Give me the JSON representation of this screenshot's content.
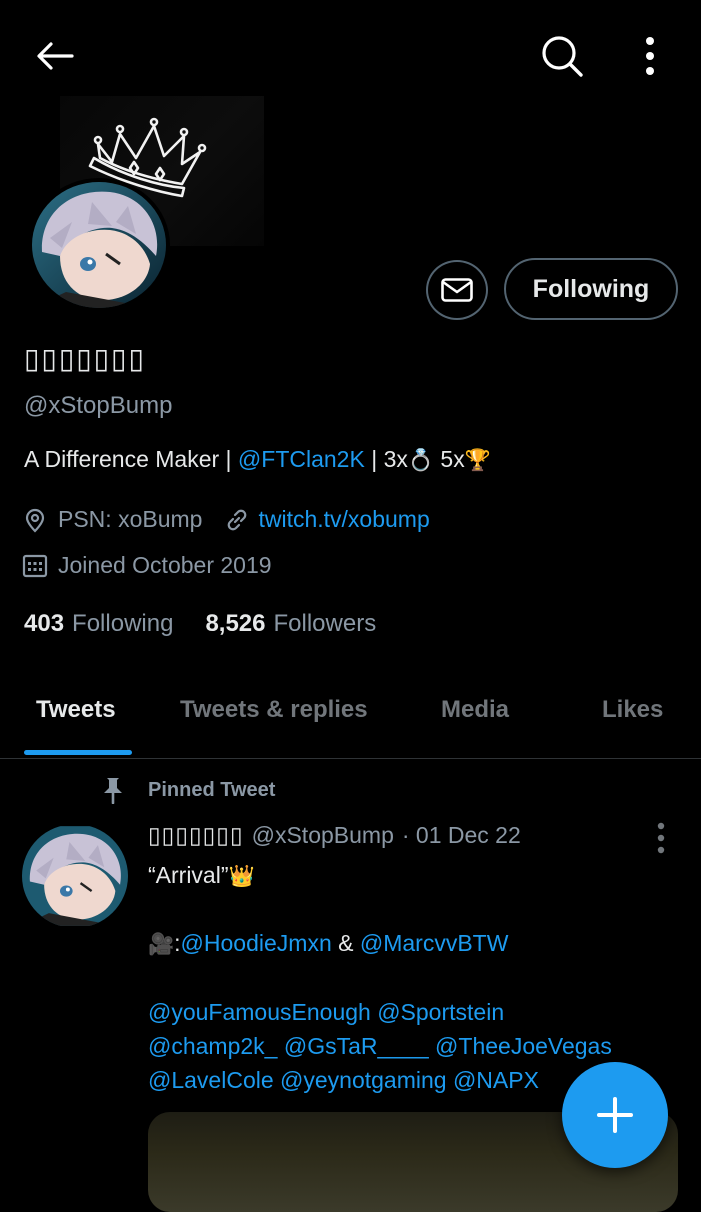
{
  "header": {
    "back_icon": "arrow-left-icon",
    "search_icon": "search-icon",
    "more_icon": "more-vertical-icon"
  },
  "profile": {
    "display_name": "▯▯▯▯▯▯▯",
    "handle": "@xStopBump",
    "bio": {
      "text1": "A Difference Maker | ",
      "mention": "@FTClan2K",
      "text2": " | 3x",
      "emoji1": "💍",
      "text3": " 5x",
      "emoji2": "🏆"
    },
    "location": "PSN: xoBump",
    "website": "twitch.tv/xobump",
    "joined": "Joined October 2019",
    "following_count": "403",
    "following_label": "Following",
    "followers_count": "8,526",
    "followers_label": "Followers",
    "follow_button": "Following"
  },
  "tabs": [
    {
      "label": "Tweets",
      "active": true
    },
    {
      "label": "Tweets & replies",
      "active": false
    },
    {
      "label": "Media",
      "active": false
    },
    {
      "label": "Likes",
      "active": false
    }
  ],
  "tweet": {
    "pinned_label": "Pinned Tweet",
    "author_name": "▯▯▯▯▯▯▯",
    "author_handle": "@xStopBump",
    "date": "· 01 Dec 22",
    "line1": "“Arrival”",
    "line1_emoji": "👑",
    "line2_emoji": "🎥",
    "line2_sep": ":",
    "mention_a": "@HoodieJmxn",
    "amp": " & ",
    "mention_b": "@MarcvvBTW",
    "line3": "@youFamousEnough @Sportstein",
    "line4": "@champ2k_ @GsTaR____ @TheeJoeVegas",
    "line5": "@LavelCole @yeynotgaming @NAPX"
  },
  "fab": {
    "icon": "plus-icon"
  },
  "colors": {
    "accent": "#1d9bf0",
    "background": "#000000",
    "text": "#e7e9ea",
    "muted": "#8b98a5"
  }
}
